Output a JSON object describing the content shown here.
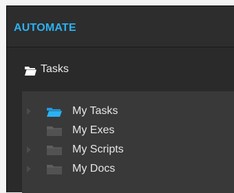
{
  "app": {
    "title": "AUTOMATE"
  },
  "section": {
    "title": "Tasks",
    "icon": "folder-open-icon"
  },
  "tree": {
    "items": [
      {
        "label": "My Tasks",
        "icon": "folder-open-icon",
        "has_children": true,
        "selected": true
      },
      {
        "label": "My Exes",
        "icon": "folder-icon",
        "has_children": false,
        "selected": false
      },
      {
        "label": "My Scripts",
        "icon": "folder-icon",
        "has_children": true,
        "selected": false
      },
      {
        "label": "My Docs",
        "icon": "folder-icon",
        "has_children": true,
        "selected": false
      }
    ]
  },
  "colors": {
    "accent": "#2bb2f3",
    "background": "#2a2a2a",
    "panel": "#393939",
    "text": "#e6e6e6",
    "folder_inactive": "#5a5a5a"
  }
}
